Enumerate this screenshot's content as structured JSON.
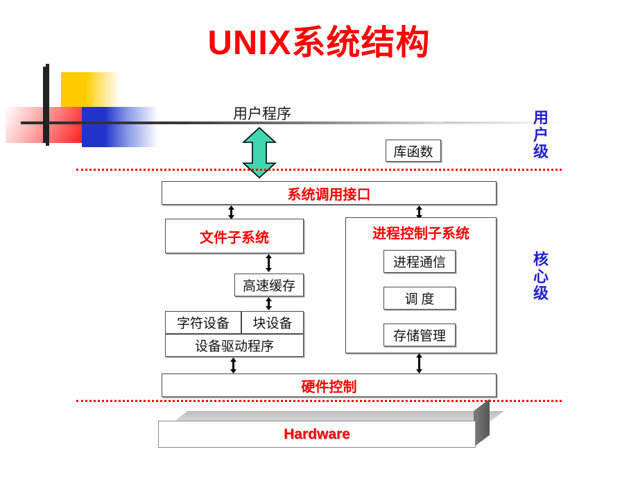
{
  "slide": {
    "title": "UNIX系统结构",
    "title_color": "#ff0000",
    "background": "#ffffff"
  },
  "side_labels": {
    "user_level": [
      "用",
      "户",
      "级"
    ],
    "kernel_level": [
      "核",
      "心",
      "级"
    ],
    "color": "#2222cc"
  },
  "diagram": {
    "user_program": "用户程序",
    "library_functions": "库函数",
    "system_call_interface": "系统调用接口",
    "file_subsystem": "文件子系统",
    "process_control_subsystem": "进程控制子系统",
    "process_communication": "进程通信",
    "scheduling": "调  度",
    "memory_management": "存储管理",
    "cache": "高速缓存",
    "character_device": "字符设备",
    "block_device": "块设备",
    "device_driver": "设备驱动程序",
    "hardware_control": "硬件控制",
    "hardware": "Hardware",
    "accent_red": "#ff0000",
    "arrow_green": "#3fd6b0",
    "separator_color": "#ff0000"
  },
  "icons": {
    "green_double_arrow": "green-double-arrow-icon",
    "black_double_arrow": "black-double-arrow-icon",
    "decorative_blocks": "decorative-color-blocks-icon"
  }
}
